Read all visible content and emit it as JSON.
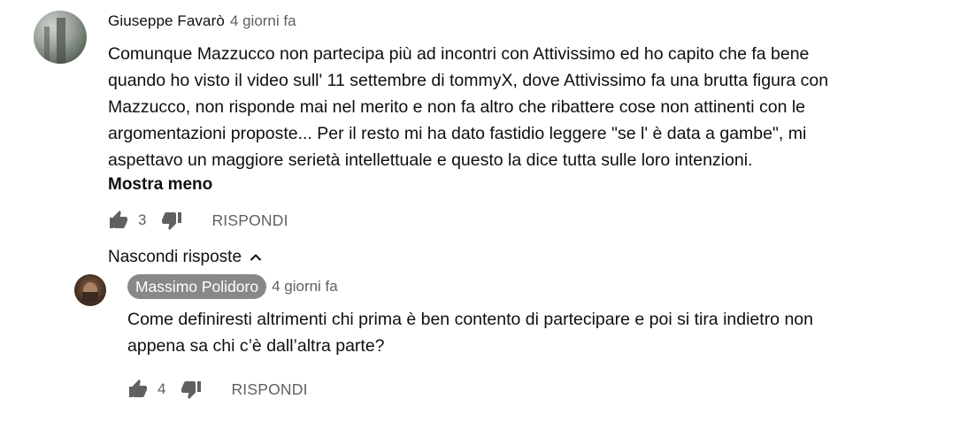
{
  "comment": {
    "author": "Giuseppe Favarò",
    "time": "4 giorni fa",
    "text_lines": [
      "Comunque Mazzucco non partecipa più ad incontri con Attivissimo ed ho capito che fa bene",
      "quando ho visto il video sull' 11 settembre di tommyX, dove Attivissimo fa una brutta figura con",
      "Mazzucco, non risponde mai nel merito e non fa altro che ribattere cose non attinenti con le",
      "argomentazioni proposte... Per il resto mi ha dato fastidio leggere \"se l' è data a gambe\", mi",
      "aspettavo un maggiore serietà intellettuale e questo la dice tutta sulle loro intenzioni."
    ],
    "show_less": "Mostra meno",
    "likes": "3",
    "reply_label": "RISPONDI",
    "hide_replies": "Nascondi risposte",
    "icons": {
      "like": "thumb-up-icon",
      "dislike": "thumb-down-icon",
      "toggle": "chevron-up-icon"
    }
  },
  "reply": {
    "author": "Massimo Polidoro",
    "time": "4 giorni fa",
    "text_lines": [
      "Come definiresti altrimenti chi prima è ben contento di partecipare e poi si tira indietro non",
      "appena sa chi c’è dall’altra parte?"
    ],
    "likes": "4",
    "reply_label": "RISPONDI"
  },
  "colors": {
    "secondary_text": "#606060",
    "author_pill": "#888888",
    "text": "#0f0f0f"
  }
}
